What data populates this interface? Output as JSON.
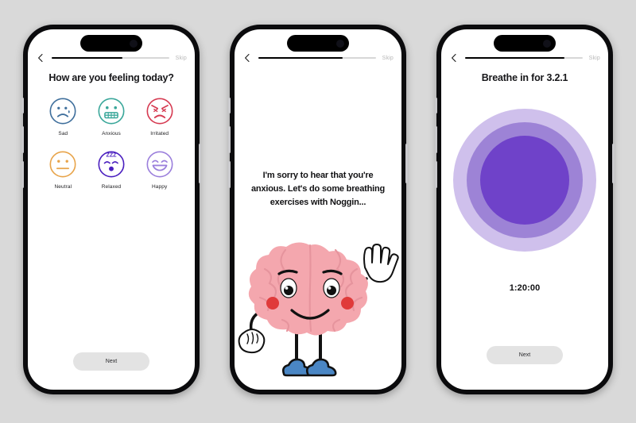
{
  "background_color": "#d9d9d9",
  "device": {
    "frame_color": "#0b0b0d",
    "screen_color": "#ffffff",
    "island_label": "dynamic-island"
  },
  "nav": {
    "back_icon": "chevron-left-icon",
    "skip_label": "Skip"
  },
  "screens": [
    {
      "id": "mood-picker",
      "progress_percent": 60,
      "title": "How are you feeling today?",
      "moods": [
        {
          "label": "Sad",
          "icon": "sad-face-icon",
          "color": "#3f6f9c"
        },
        {
          "label": "Anxious",
          "icon": "anxious-face-icon",
          "color": "#3aa79a"
        },
        {
          "label": "Irritated",
          "icon": "irritated-face-icon",
          "color": "#d63b52"
        },
        {
          "label": "Neutral",
          "icon": "neutral-face-icon",
          "color": "#e8a44a"
        },
        {
          "label": "Relaxed",
          "icon": "relaxed-face-icon",
          "color": "#4a1fbf"
        },
        {
          "label": "Happy",
          "icon": "happy-face-icon",
          "color": "#9b7fdc"
        }
      ],
      "next_label": "Next"
    },
    {
      "id": "mascot-message",
      "progress_percent": 72,
      "message": "I'm sorry to hear that you're anxious. Let's do some breathing exercises with Noggin...",
      "mascot": {
        "name": "noggin-brain-mascot",
        "brain_color": "#f4a7ae",
        "brain_outline": "#e8949d",
        "cheek_color": "#e03a3a",
        "glove_color": "#ffffff",
        "shoe_color": "#4a86c4"
      }
    },
    {
      "id": "breathing-timer",
      "progress_percent": 85,
      "title": "Breathe in for 3.2.1",
      "rings": [
        {
          "name": "ring-outer",
          "color": "#cfc0ec"
        },
        {
          "name": "ring-middle",
          "color": "#9d83d6"
        },
        {
          "name": "ring-inner",
          "color": "#6f42c9"
        }
      ],
      "timer": "1:20:00",
      "next_label": "Next"
    }
  ]
}
